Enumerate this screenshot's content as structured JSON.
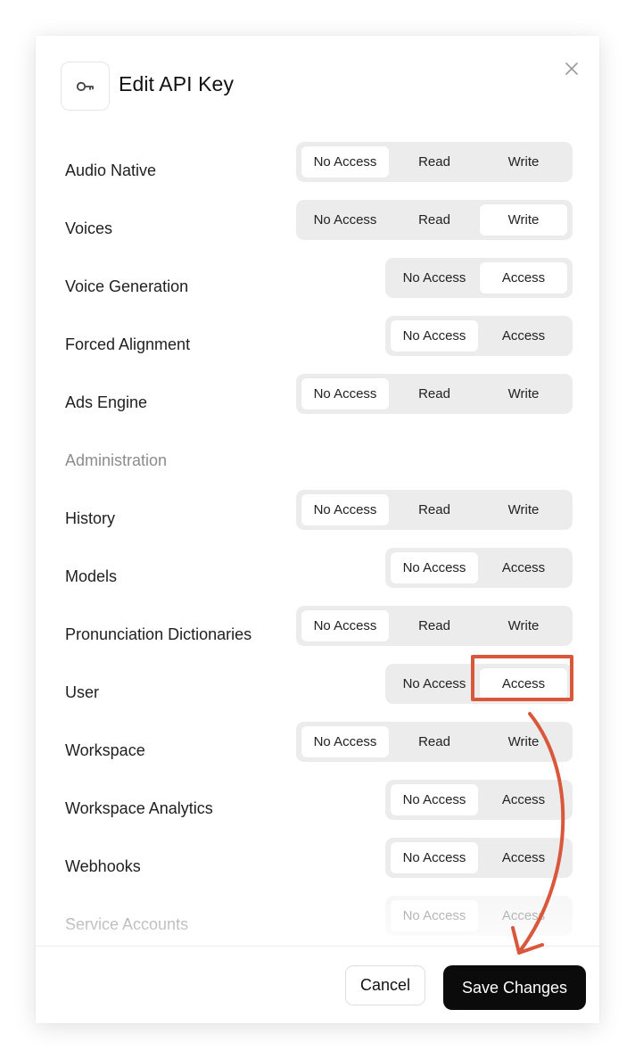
{
  "dialog": {
    "title": "Edit API Key",
    "icon": "key-icon",
    "close_icon": "close-icon"
  },
  "options": {
    "no_access": "No Access",
    "read": "Read",
    "write": "Write",
    "access": "Access"
  },
  "rows": [
    {
      "label": "Audio Native",
      "type": "three",
      "selected": "No Access"
    },
    {
      "label": "Voices",
      "type": "three",
      "selected": "Write"
    },
    {
      "label": "Voice Generation",
      "type": "two",
      "selected": "Access"
    },
    {
      "label": "Forced Alignment",
      "type": "two",
      "selected": "No Access"
    },
    {
      "label": "Ads Engine",
      "type": "three",
      "selected": "No Access"
    },
    {
      "section": "Administration"
    },
    {
      "label": "History",
      "type": "three",
      "selected": "No Access"
    },
    {
      "label": "Models",
      "type": "two",
      "selected": "No Access"
    },
    {
      "label": "Pronunciation Dictionaries",
      "type": "three",
      "selected": "No Access"
    },
    {
      "label": "User",
      "type": "two",
      "selected": "Access"
    },
    {
      "label": "Workspace",
      "type": "three",
      "selected": "No Access"
    },
    {
      "label": "Workspace Analytics",
      "type": "two",
      "selected": "No Access"
    },
    {
      "label": "Webhooks",
      "type": "two",
      "selected": "No Access"
    },
    {
      "label": "Service Accounts",
      "type": "two",
      "selected": "No Access"
    }
  ],
  "footer": {
    "cancel_label": "Cancel",
    "save_label": "Save Changes"
  },
  "annotation": {
    "color": "#d9573b",
    "highlight_target": "User access option",
    "arrow_target": "save-changes-button"
  }
}
